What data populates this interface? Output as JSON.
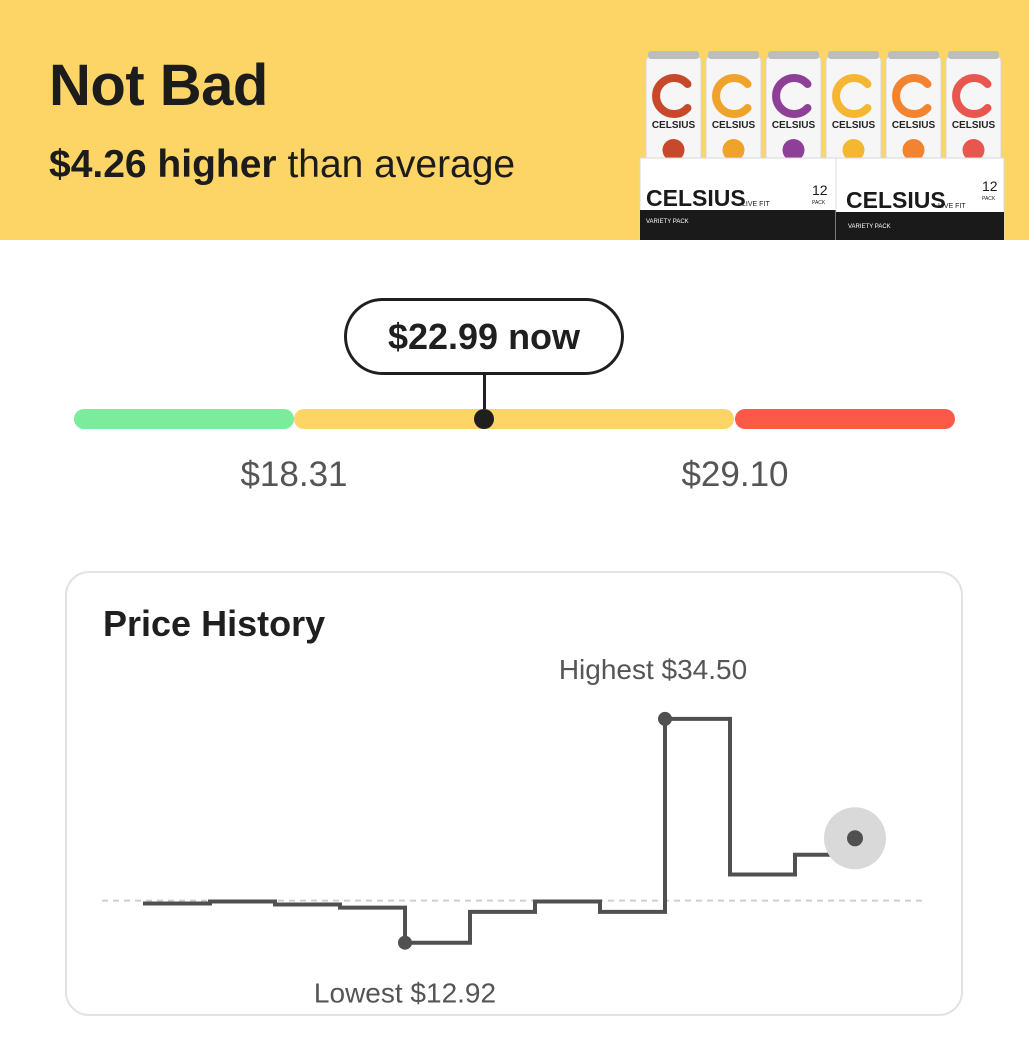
{
  "header": {
    "verdict": "Not Bad",
    "diff_strong": "$4.26 higher",
    "diff_rest": " than average",
    "background_color": "#fcd566",
    "product": {
      "brand": "CELSIUS",
      "brand_sub": "LIVE FIT",
      "pack_count": "12",
      "pack_unit": "PACK",
      "pack_label": "VARIETY PACK"
    }
  },
  "price_gauge": {
    "current_label": "$22.99 now",
    "current_value": 22.99,
    "low_threshold_label": "$18.31",
    "high_threshold_label": "$29.10",
    "colors": {
      "good": "#7deb9c",
      "average": "#fcd566",
      "high": "#fb5a48"
    }
  },
  "history": {
    "title": "Price History",
    "highest_label": "Highest $34.50",
    "lowest_label": "Lowest $12.92"
  },
  "chart_data": {
    "type": "line",
    "title": "Price History",
    "step": true,
    "reference_line": "dashed average",
    "values": [
      16.7,
      16.9,
      16.6,
      16.3,
      12.92,
      15.9,
      16.9,
      15.9,
      34.5,
      19.5,
      21.4,
      22.99
    ],
    "highest": 34.5,
    "lowest": 12.92,
    "current": 22.99,
    "ylim": [
      10,
      37
    ]
  }
}
